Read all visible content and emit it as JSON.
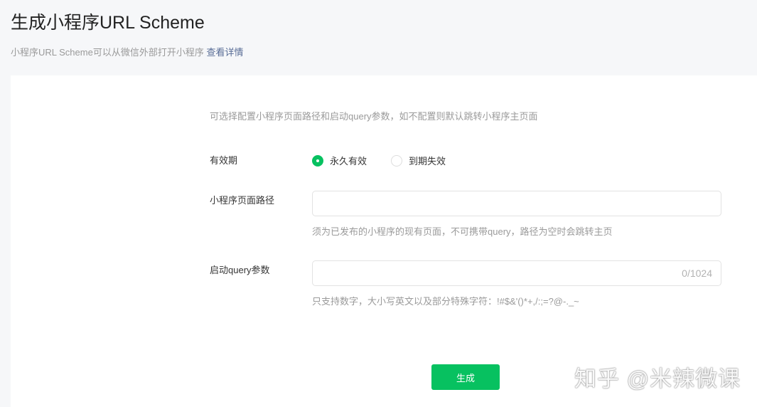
{
  "header": {
    "title": "生成小程序URL Scheme",
    "subtitle": "小程序URL Scheme可以从微信外部打开小程序",
    "link": "查看详情"
  },
  "form": {
    "hint": "可选择配置小程序页面路径和启动query参数，如不配置则默认跳转小程序主页面",
    "validity": {
      "label": "有效期",
      "options": [
        {
          "label": "永久有效",
          "selected": true
        },
        {
          "label": "到期失效",
          "selected": false
        }
      ]
    },
    "path": {
      "label": "小程序页面路径",
      "value": "",
      "tip": "须为已发布的小程序的现有页面，不可携带query，路径为空时会跳转主页"
    },
    "query": {
      "label": "启动query参数",
      "value": "",
      "counter": "0/1024",
      "tip": "只支持数字，大小写英文以及部分特殊字符：!#$&'()*+,/:;=?@-._~"
    },
    "submit": "生成"
  },
  "watermark": "知乎 @米辣微课",
  "colors": {
    "accent": "#07c160",
    "link": "#576b95"
  }
}
